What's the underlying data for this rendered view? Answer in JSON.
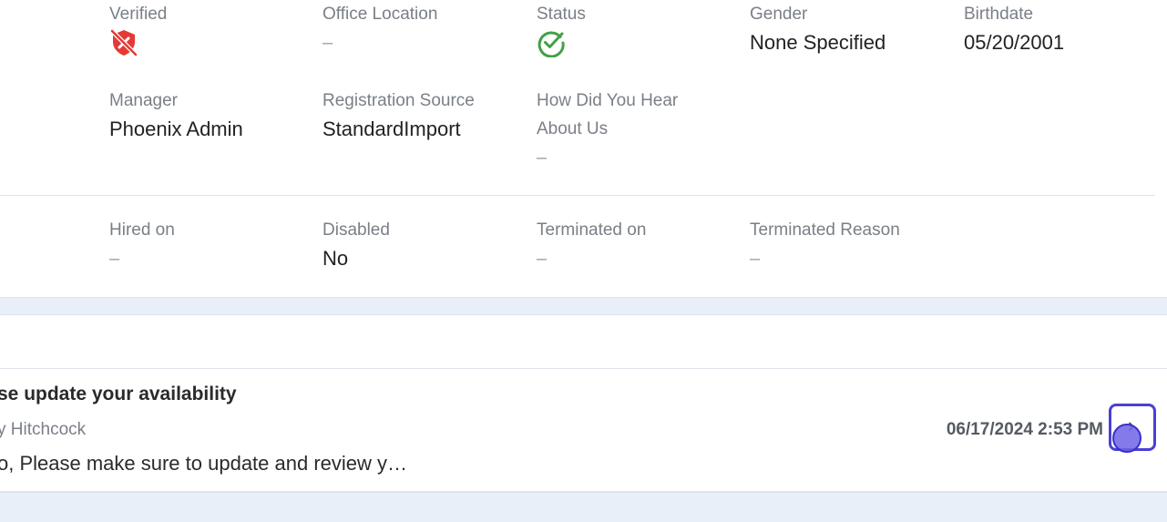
{
  "profile": {
    "verified": {
      "label": "Verified",
      "icon": "shield-off-icon",
      "color": "#e53935"
    },
    "office_location": {
      "label": "Office Location",
      "value": "–"
    },
    "status": {
      "label": "Status",
      "icon": "check-circle-icon",
      "color": "#43a047"
    },
    "gender": {
      "label": "Gender",
      "value": "None Specified"
    },
    "birthdate": {
      "label": "Birthdate",
      "value": "05/20/2001"
    },
    "manager": {
      "label": "Manager",
      "value": "Phoenix Admin"
    },
    "registration_source": {
      "label": "Registration Source",
      "value": "StandardImport"
    },
    "how_did_you_hear": {
      "label": "How Did You Hear About Us",
      "value": "–"
    }
  },
  "employment": {
    "hired_on": {
      "label": "Hired on",
      "value": "–"
    },
    "disabled": {
      "label": "Disabled",
      "value": "No"
    },
    "terminated_on": {
      "label": "Terminated on",
      "value": "–"
    },
    "terminated_reason": {
      "label": "Terminated Reason",
      "value": "–"
    }
  },
  "messages": [
    {
      "subject": "se update your availability",
      "sender": "y Hitchcock",
      "date": "06/17/2024 2:53 PM",
      "preview": "o, Please make sure to update and review y…",
      "action_icon": "chevron-right-icon"
    }
  ],
  "colors": {
    "accent": "#4a3fd6",
    "page_background": "#e8eff8"
  }
}
